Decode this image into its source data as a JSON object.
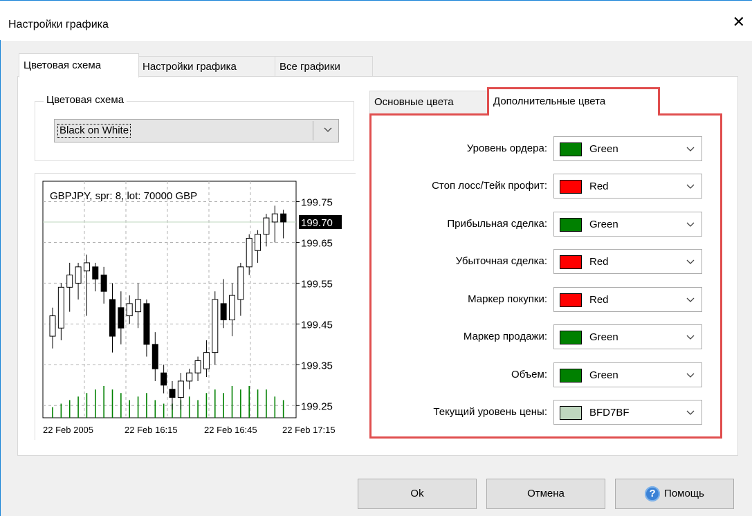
{
  "window": {
    "title": "Настройки графика",
    "close_glyph": "✕"
  },
  "tabs": [
    "Цветовая схема",
    "Настройки графика",
    "Все графики"
  ],
  "scheme": {
    "legend": "Цветовая схема",
    "value": "Black on White"
  },
  "subtabs": [
    "Основные цвета",
    "Дополнительные цвета"
  ],
  "colors": [
    {
      "label": "Уровень ордера:",
      "name": "Green",
      "hex": "#008000"
    },
    {
      "label": "Стоп лосс/Тейк профит:",
      "name": "Red",
      "hex": "#ff0000"
    },
    {
      "label": "Прибыльная сделка:",
      "name": "Green",
      "hex": "#008000"
    },
    {
      "label": "Убыточная сделка:",
      "name": "Red",
      "hex": "#ff0000"
    },
    {
      "label": "Маркер покупки:",
      "name": "Red",
      "hex": "#ff0000"
    },
    {
      "label": "Маркер продажи:",
      "name": "Green",
      "hex": "#008000"
    },
    {
      "label": "Объем:",
      "name": "Green",
      "hex": "#008000"
    },
    {
      "label": "Текущий уровень цены:",
      "name": "BFD7BF",
      "hex": "#bfd7bf"
    }
  ],
  "buttons": {
    "ok": "Ok",
    "cancel": "Отмена",
    "help": "Помощь",
    "help_glyph": "?"
  },
  "highlight_color": "#e04e4e",
  "chart_data": {
    "type": "candlestick",
    "title": "GBPJPY, spr: 8, lot: 70000 GBP",
    "y_ticks": [
      "199.75",
      "199.65",
      "199.55",
      "199.45",
      "199.35",
      "199.25"
    ],
    "current_price": "199.70",
    "x_ticks": [
      "22 Feb 2005",
      "22 Feb 16:15",
      "22 Feb 16:45",
      "22 Feb 17:15"
    ],
    "ylim": [
      199.22,
      199.8
    ],
    "up_color": "#ffffff",
    "down_color": "#000000",
    "volume_color": "#008000",
    "current_line_color": "#bfd7bf",
    "candles": [
      {
        "o": 199.42,
        "h": 199.49,
        "l": 199.39,
        "c": 199.47
      },
      {
        "o": 199.44,
        "h": 199.55,
        "l": 199.41,
        "c": 199.54
      },
      {
        "o": 199.54,
        "h": 199.6,
        "l": 199.48,
        "c": 199.57
      },
      {
        "o": 199.55,
        "h": 199.6,
        "l": 199.51,
        "c": 199.59
      },
      {
        "o": 199.58,
        "h": 199.62,
        "l": 199.47,
        "c": 199.6
      },
      {
        "o": 199.59,
        "h": 199.6,
        "l": 199.53,
        "c": 199.56
      },
      {
        "o": 199.57,
        "h": 199.59,
        "l": 199.5,
        "c": 199.53
      },
      {
        "o": 199.51,
        "h": 199.55,
        "l": 199.38,
        "c": 199.42
      },
      {
        "o": 199.49,
        "h": 199.53,
        "l": 199.4,
        "c": 199.44
      },
      {
        "o": 199.47,
        "h": 199.52,
        "l": 199.45,
        "c": 199.5
      },
      {
        "o": 199.48,
        "h": 199.55,
        "l": 199.44,
        "c": 199.51
      },
      {
        "o": 199.5,
        "h": 199.51,
        "l": 199.37,
        "c": 199.4
      },
      {
        "o": 199.4,
        "h": 199.43,
        "l": 199.31,
        "c": 199.34
      },
      {
        "o": 199.33,
        "h": 199.35,
        "l": 199.28,
        "c": 199.3
      },
      {
        "o": 199.29,
        "h": 199.31,
        "l": 199.24,
        "c": 199.27
      },
      {
        "o": 199.27,
        "h": 199.33,
        "l": 199.24,
        "c": 199.31
      },
      {
        "o": 199.31,
        "h": 199.34,
        "l": 199.29,
        "c": 199.33
      },
      {
        "o": 199.33,
        "h": 199.37,
        "l": 199.31,
        "c": 199.36
      },
      {
        "o": 199.34,
        "h": 199.41,
        "l": 199.32,
        "c": 199.38
      },
      {
        "o": 199.38,
        "h": 199.53,
        "l": 199.35,
        "c": 199.51
      },
      {
        "o": 199.5,
        "h": 199.56,
        "l": 199.44,
        "c": 199.46
      },
      {
        "o": 199.46,
        "h": 199.55,
        "l": 199.42,
        "c": 199.52
      },
      {
        "o": 199.51,
        "h": 199.6,
        "l": 199.47,
        "c": 199.59
      },
      {
        "o": 199.59,
        "h": 199.67,
        "l": 199.57,
        "c": 199.66
      },
      {
        "o": 199.63,
        "h": 199.68,
        "l": 199.6,
        "c": 199.67
      },
      {
        "o": 199.67,
        "h": 199.72,
        "l": 199.64,
        "c": 199.71
      },
      {
        "o": 199.7,
        "h": 199.74,
        "l": 199.65,
        "c": 199.72
      },
      {
        "o": 199.72,
        "h": 199.73,
        "l": 199.66,
        "c": 199.7
      }
    ],
    "volumes": [
      3,
      4,
      5,
      6,
      7,
      8,
      9,
      8,
      7,
      5,
      6,
      7,
      5,
      4,
      4,
      5,
      6,
      5,
      7,
      8,
      7,
      9,
      8,
      9,
      8,
      8,
      6,
      5
    ]
  }
}
